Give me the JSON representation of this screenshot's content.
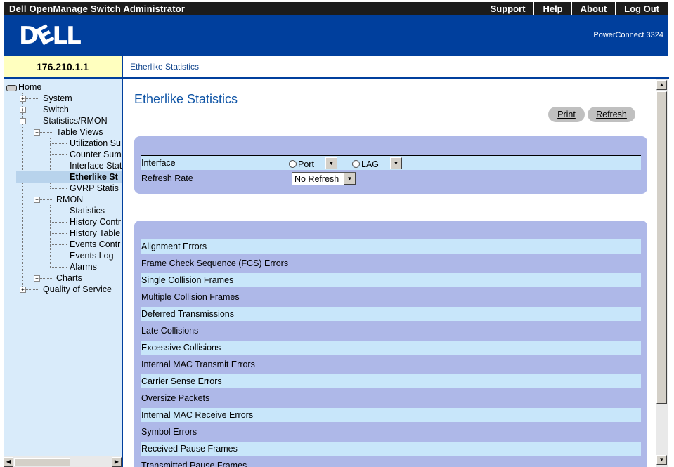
{
  "header": {
    "app_title": "Dell OpenManage Switch Administrator",
    "links": [
      "Support",
      "Help",
      "About",
      "Log Out"
    ],
    "logo": "DELL",
    "product": "PowerConnect 3324"
  },
  "ip_address": "176.210.1.1",
  "breadcrumb": "Etherlike Statistics",
  "tree": {
    "home": "Home",
    "system": "System",
    "switch": "Switch",
    "statistics_rmon": "Statistics/RMON",
    "table_views": "Table Views",
    "utilization": "Utilization Su",
    "counter": "Counter Sum",
    "interface_stat": "Interface Stat",
    "etherlike": "Etherlike St",
    "gvrp": "GVRP Statis",
    "rmon": "RMON",
    "statistics": "Statistics",
    "history_control": "History Contr",
    "history_table": "History Table",
    "events_control": "Events Contr",
    "events_log": "Events Log",
    "alarms": "Alarms",
    "charts": "Charts",
    "qos": "Quality of Service"
  },
  "main": {
    "title": "Etherlike Statistics",
    "print_label": "Print",
    "refresh_label": "Refresh",
    "interface_label": "Interface",
    "port_label": "Port",
    "lag_label": "LAG",
    "refresh_rate_label": "Refresh Rate",
    "refresh_rate_value": "No Refresh",
    "stats": [
      "Alignment Errors",
      "Frame Check Sequence (FCS) Errors",
      "Single Collision Frames",
      "Multiple Collision Frames",
      "Deferred Transmissions",
      "Late Collisions",
      "Excessive Collisions",
      "Internal MAC Transmit Errors",
      "Carrier Sense Errors",
      "Oversize Packets",
      "Internal MAC Receive Errors",
      "Symbol Errors",
      "Received Pause Frames",
      "Transmitted Pause Frames"
    ]
  }
}
